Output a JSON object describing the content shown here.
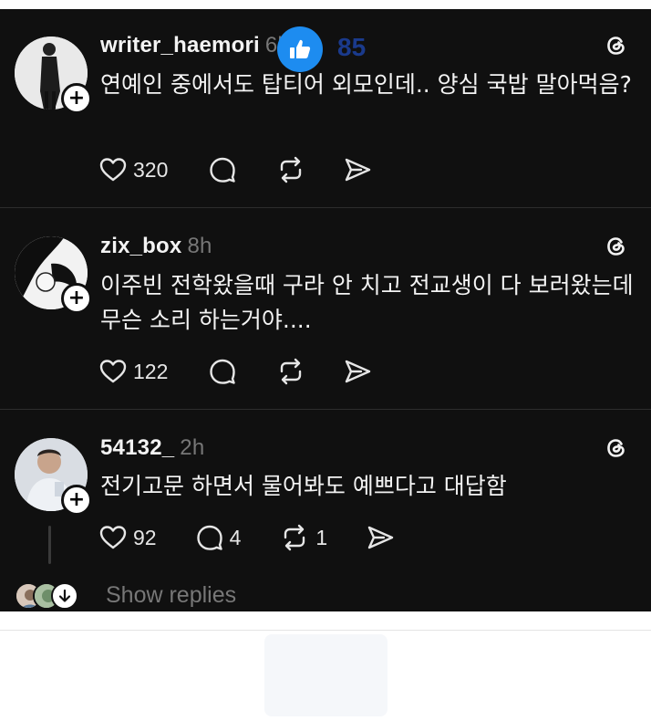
{
  "colors": {
    "background": "#101010",
    "text": "#f3f3f3",
    "muted": "#777777",
    "like_blue": "#1d8cf0",
    "like_count": "#1a3a8c"
  },
  "posts": [
    {
      "username": "writer_haemori",
      "time": "6h",
      "text": "연예인 중에서도 탑티어 외모인데.. 양심 국밥 말아먹음?",
      "likes": "320",
      "comments": "",
      "reposts": ""
    },
    {
      "username": "zix_box",
      "time": "8h",
      "text": "이주빈 전학왔을때 구라 안 치고 전교생이 다 보러왔는데 무슨 소리 하는거야....",
      "likes": "122",
      "comments": "",
      "reposts": ""
    },
    {
      "username": "54132_",
      "time": "2h",
      "text": "전기고문 하면서 물어봐도 예쁘다고 대답함",
      "likes": "92",
      "comments": "4",
      "reposts": "1"
    }
  ],
  "show_replies_label": "Show replies",
  "reaction": {
    "count": "85"
  },
  "icons": {
    "follow": "plus-icon",
    "app": "threads-icon",
    "like": "heart-icon",
    "comment": "comment-icon",
    "repost": "repost-icon",
    "share": "send-icon",
    "expand": "arrow-down-icon",
    "reaction": "thumbs-up-icon"
  }
}
